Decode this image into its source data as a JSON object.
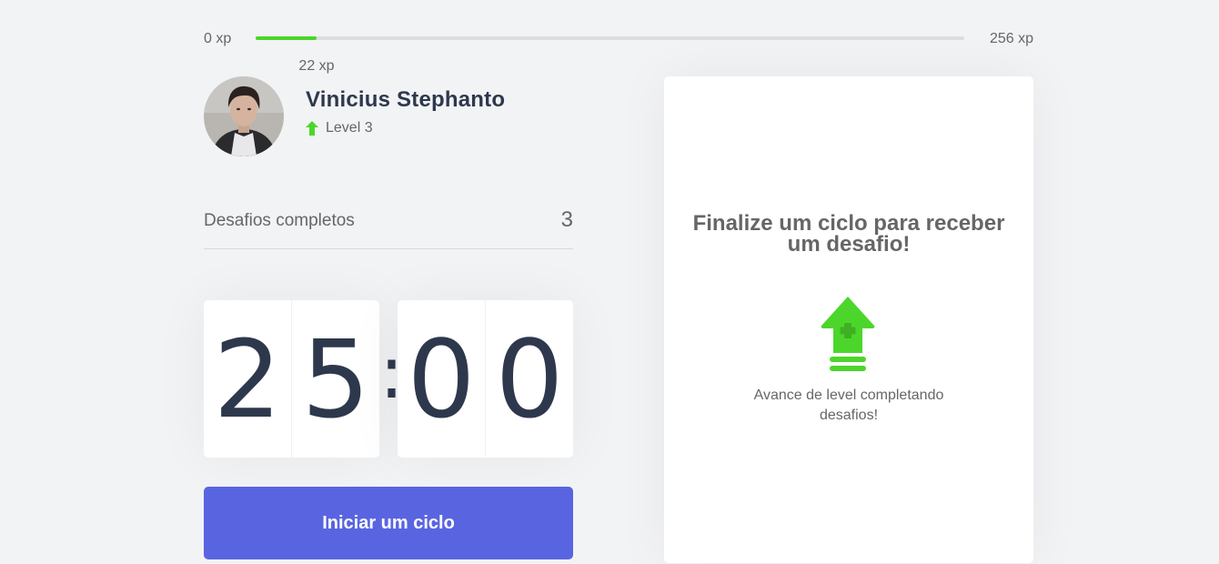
{
  "experience": {
    "min_label": "0 xp",
    "max_label": "256 xp",
    "current_label": "22 xp",
    "current_xp": 22,
    "max_xp": 256,
    "progress_fraction": 0.086
  },
  "profile": {
    "name": "Vinicius Stephanto",
    "level_label": "Level 3"
  },
  "completed": {
    "label": "Desafios completos",
    "count": "3"
  },
  "countdown": {
    "minute_left": "2",
    "minute_right": "5",
    "separator": ":",
    "second_left": "0",
    "second_right": "0"
  },
  "actions": {
    "start_label": "Iniciar um ciclo"
  },
  "challenge": {
    "title": "Finalize um ciclo para receber um desafio!",
    "description": "Avance de level completando desafios!"
  },
  "colors": {
    "accent_green": "#4cd62b",
    "button_blue": "#5965e0",
    "title_dark": "#2e384d",
    "text_gray": "#666666",
    "background": "#f2f3f5"
  },
  "icons": {
    "level": "level-up-arrow-icon",
    "challenge": "level-up-arrow-icon"
  }
}
